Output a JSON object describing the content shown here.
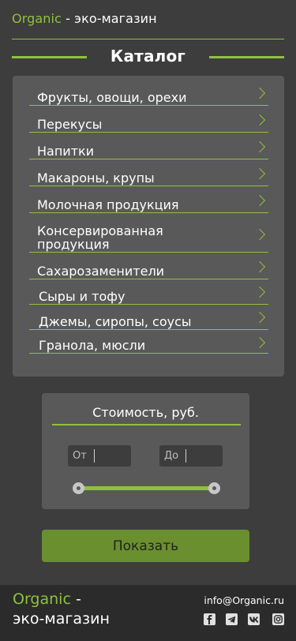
{
  "header": {
    "brand": "Organic",
    "rest": " - эко-магазин"
  },
  "catalog": {
    "title": "Каталог",
    "items": [
      {
        "label": "Фрукты, овощи, орехи"
      },
      {
        "label": "Перекусы"
      },
      {
        "label": "Напитки"
      },
      {
        "label": "Макароны, крупы"
      },
      {
        "label": "Молочная продукция"
      },
      {
        "label_line1": "Консервированная",
        "label_line2": "продукция"
      },
      {
        "label": "Сахарозаменители"
      },
      {
        "label": "Сыры и тофу"
      },
      {
        "label": "Джемы, сиропы, соусы"
      },
      {
        "label": "Гранола, мюсли"
      }
    ]
  },
  "price": {
    "title": "Стоимость, руб.",
    "from_placeholder": "От",
    "to_placeholder": "До",
    "slider_min_fraction": 0,
    "slider_max_fraction": 1
  },
  "show_button": "Показать",
  "footer": {
    "brand": "Organic",
    "dash": " -",
    "subtitle": "эко-магазин",
    "email": "info@Organic.ru",
    "social_icons": [
      "facebook-icon",
      "telegram-icon",
      "vk-icon",
      "instagram-icon"
    ]
  },
  "colors": {
    "accent": "#8fc13e",
    "button": "#6a8f2e",
    "background": "#3d3d3d",
    "panel": "#595959",
    "footer": "#2b2b2b"
  }
}
